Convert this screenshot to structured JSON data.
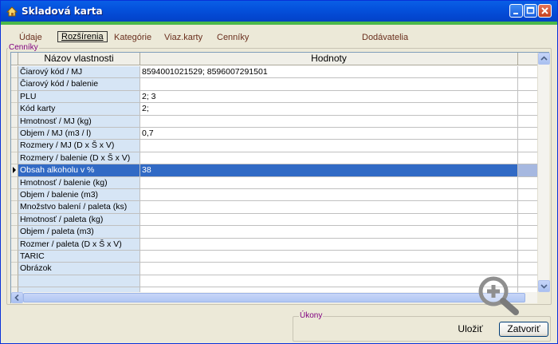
{
  "window": {
    "title": "Skladová karta"
  },
  "tabs": [
    {
      "label": "Údaje"
    },
    {
      "label": "Rozšírenia"
    },
    {
      "label": "Kategórie"
    },
    {
      "label": "Viaz.karty"
    },
    {
      "label": "Cenníky"
    },
    {
      "label": "Dodávatelia"
    }
  ],
  "groups": {
    "top_label": "Cenníky",
    "bottom_label": "Úkony"
  },
  "grid": {
    "columns": [
      "Názov vlastnosti",
      "Hodnoty"
    ],
    "rows": [
      {
        "name": "Čiarový kód / MJ",
        "value": "8594001021529; 8596007291501"
      },
      {
        "name": "Čiarový kód / balenie",
        "value": ""
      },
      {
        "name": "PLU",
        "value": "2; 3"
      },
      {
        "name": "Kód karty",
        "value": "2;"
      },
      {
        "name": "Hmotnosť / MJ (kg)",
        "value": ""
      },
      {
        "name": "Objem / MJ (m3 / l)",
        "value": " 0,7"
      },
      {
        "name": "Rozmery / MJ (D x Š x V)",
        "value": ""
      },
      {
        "name": "Rozmery / balenie  (D x Š x V)",
        "value": ""
      },
      {
        "name": "Obsah alkoholu v %",
        "value": "38"
      },
      {
        "name": "Hmotnosť / balenie (kg)",
        "value": ""
      },
      {
        "name": "Objem / balenie (m3)",
        "value": ""
      },
      {
        "name": "Množstvo balení / paleta (ks)",
        "value": ""
      },
      {
        "name": "Hmotnosť / paleta (kg)",
        "value": ""
      },
      {
        "name": "Objem / paleta (m3)",
        "value": ""
      },
      {
        "name": "Rozmer / paleta (D x Š x V)",
        "value": ""
      },
      {
        "name": "TARIC",
        "value": ""
      },
      {
        "name": "Obrázok",
        "value": ""
      },
      {
        "name": "",
        "value": ""
      },
      {
        "name": "",
        "value": ""
      }
    ],
    "selected_row": 8
  },
  "buttons": {
    "save": "Uložiť",
    "close": "Zatvoriť"
  },
  "colors": {
    "title_bar": "#0451dc",
    "selection": "#316ac5",
    "name_column": "#d6e5f5",
    "accent_strip": "#4ab84c"
  }
}
